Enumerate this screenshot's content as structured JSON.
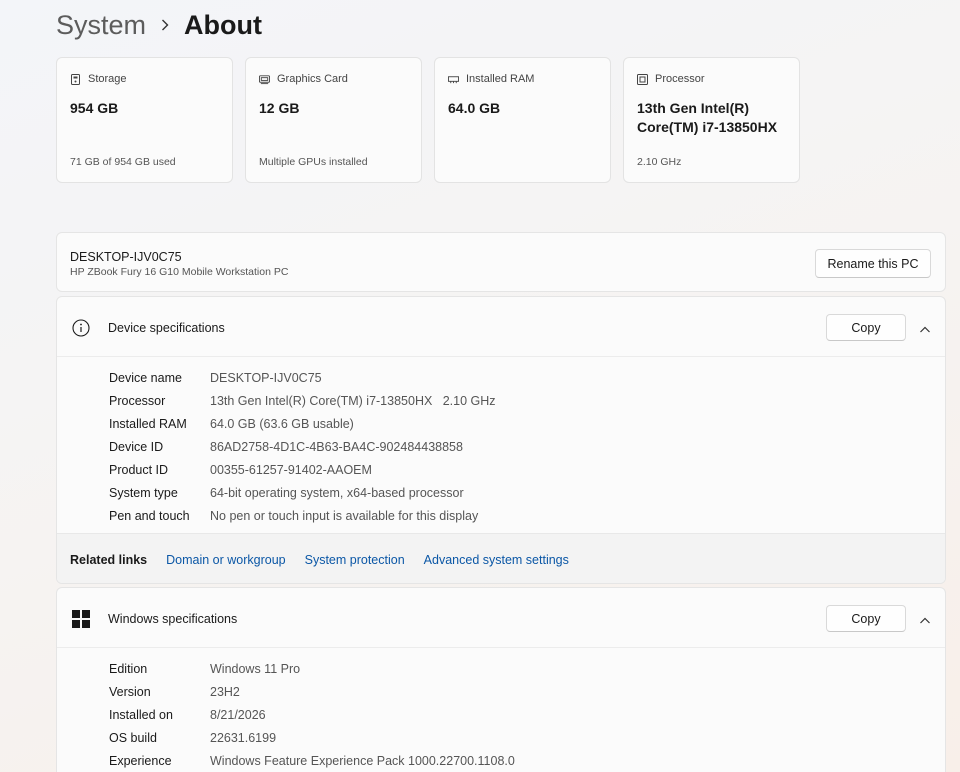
{
  "breadcrumb": {
    "parent": "System",
    "current": "About"
  },
  "cards": [
    {
      "icon": "storage-icon",
      "title": "Storage",
      "value": "954 GB",
      "sub": "71 GB of 954 GB used"
    },
    {
      "icon": "graphics-card-icon",
      "title": "Graphics Card",
      "value": "12 GB",
      "sub": "Multiple GPUs installed"
    },
    {
      "icon": "ram-icon",
      "title": "Installed RAM",
      "value": "64.0 GB",
      "sub": ""
    },
    {
      "icon": "processor-icon",
      "title": "Processor",
      "value": "13th Gen Intel(R) Core(TM) i7-13850HX",
      "sub": "2.10 GHz"
    }
  ],
  "pc": {
    "name": "DESKTOP-IJV0C75",
    "model": "HP ZBook Fury 16 G10 Mobile Workstation PC",
    "rename_label": "Rename this PC"
  },
  "device_specs": {
    "title": "Device specifications",
    "copy_label": "Copy",
    "rows": [
      {
        "label": "Device name",
        "value": "DESKTOP-IJV0C75"
      },
      {
        "label": "Processor",
        "value": "13th Gen Intel(R) Core(TM) i7-13850HX   2.10 GHz"
      },
      {
        "label": "Installed RAM",
        "value": "64.0 GB (63.6 GB usable)"
      },
      {
        "label": "Device ID",
        "value": "86AD2758-4D1C-4B63-BA4C-902484438858"
      },
      {
        "label": "Product ID",
        "value": "00355-61257-91402-AAOEM"
      },
      {
        "label": "System type",
        "value": "64-bit operating system, x64-based processor"
      },
      {
        "label": "Pen and touch",
        "value": "No pen or touch input is available for this display"
      }
    ]
  },
  "related_links": {
    "label": "Related links",
    "links": [
      "Domain or workgroup",
      "System protection",
      "Advanced system settings"
    ]
  },
  "windows_specs": {
    "title": "Windows specifications",
    "copy_label": "Copy",
    "rows": [
      {
        "label": "Edition",
        "value": "Windows 11 Pro"
      },
      {
        "label": "Version",
        "value": "23H2"
      },
      {
        "label": "Installed on",
        "value": "8/21/2026"
      },
      {
        "label": "OS build",
        "value": "22631.6199"
      },
      {
        "label": "Experience",
        "value": "Windows Feature Experience Pack 1000.22700.1108.0"
      }
    ]
  },
  "colors": {
    "link": "#0b57a6",
    "text": "#1a1a1a",
    "secondary": "#555555"
  }
}
